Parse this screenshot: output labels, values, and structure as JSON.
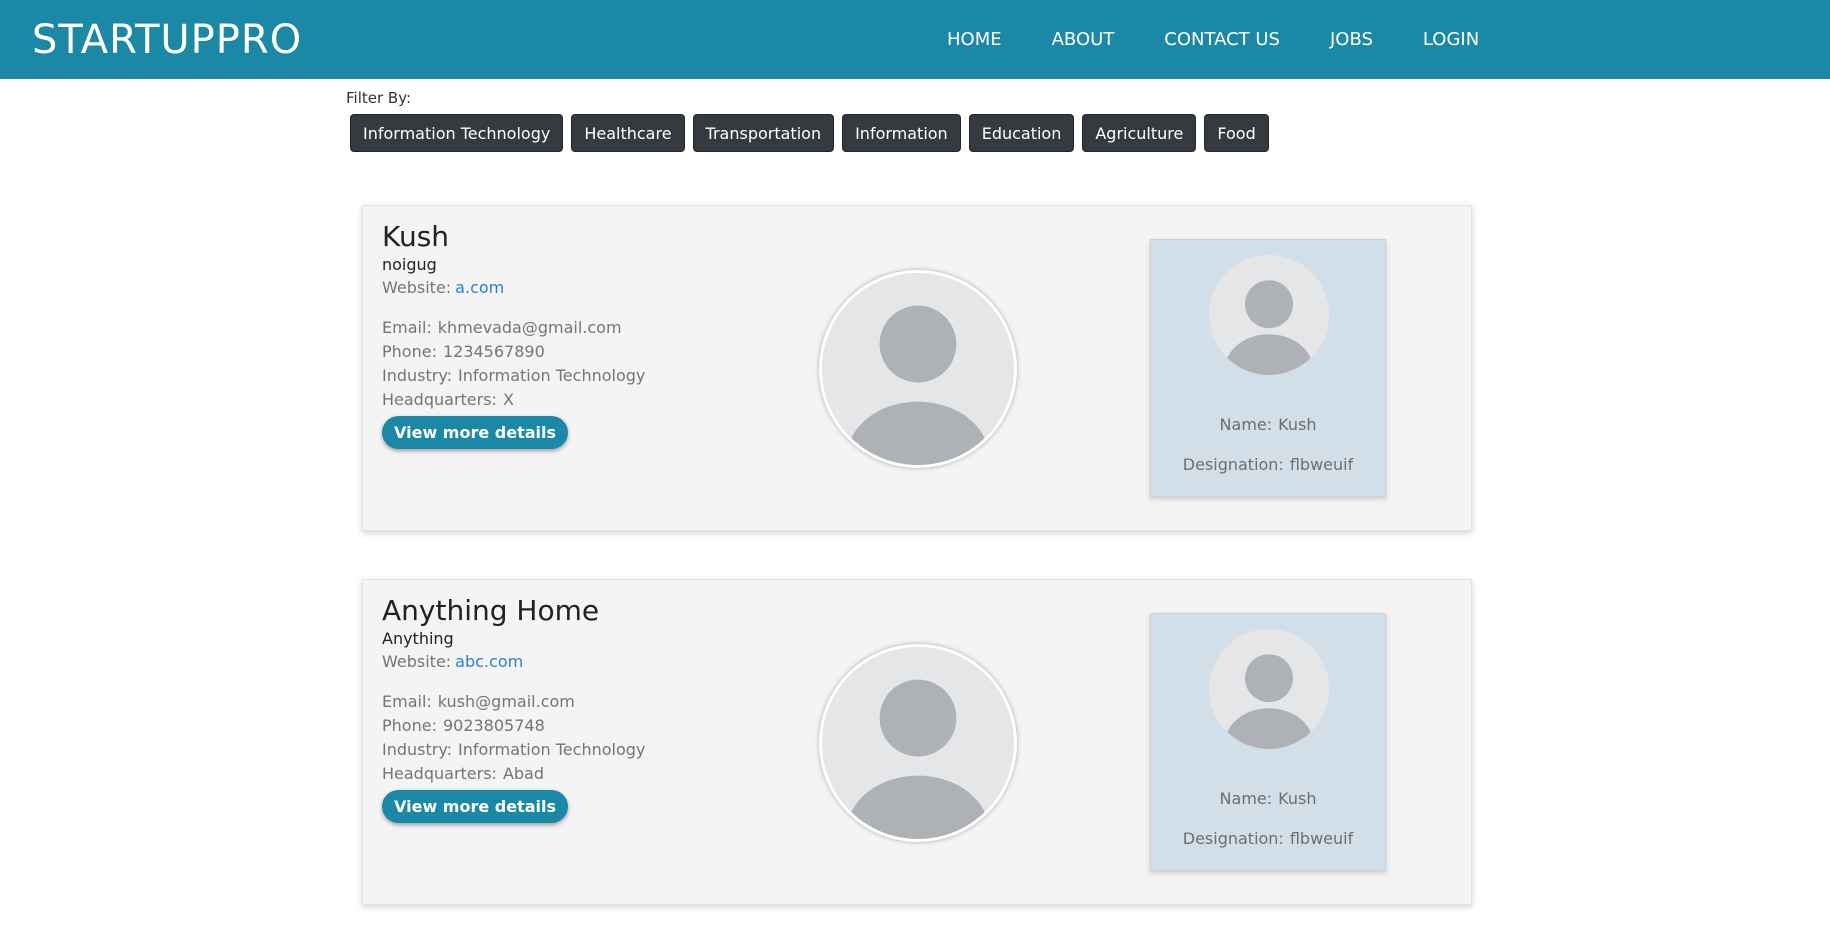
{
  "navbar": {
    "brand": "STARTUPPRO",
    "items": [
      "HOME",
      "ABOUT",
      "CONTACT US",
      "JOBS",
      "LOGIN"
    ]
  },
  "filter": {
    "label": "Filter By:",
    "options": [
      "Information Technology",
      "Healthcare",
      "Transportation",
      "Information",
      "Education",
      "Agriculture",
      "Food"
    ]
  },
  "labels": {
    "website": "Website:",
    "email": "Email:",
    "phone": "Phone:",
    "industry": "Industry:",
    "headquarters": "Headquarters:",
    "name": "Name:",
    "designation": "Designation:",
    "view_details": "View more details"
  },
  "startups": [
    {
      "name": "Kush",
      "tagline": "noigug",
      "website": "a.com",
      "email": "khmevada@gmail.com",
      "phone": "1234567890",
      "industry": "Information Technology",
      "headquarters": "X",
      "founder": {
        "name": "Kush",
        "designation": "flbweuif"
      }
    },
    {
      "name": "Anything Home",
      "tagline": "Anything",
      "website": "abc.com",
      "email": "kush@gmail.com",
      "phone": "9023805748",
      "industry": "Information Technology",
      "headquarters": "Abad",
      "founder": {
        "name": "Kush",
        "designation": "flbweuif"
      }
    }
  ],
  "colors": {
    "primary": "#1b88a6",
    "filter_button": "#343a40",
    "card_bg": "#f4f4f4",
    "founder_bg": "#d2dfe8",
    "link": "#2a7fd4"
  },
  "icons": {
    "logo": "user-silhouette-icon",
    "avatar": "user-silhouette-icon"
  }
}
